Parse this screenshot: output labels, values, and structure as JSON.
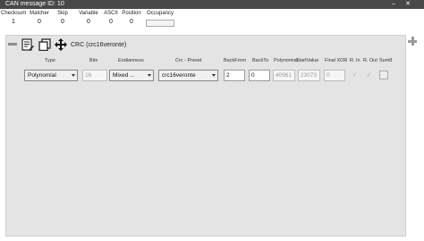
{
  "window": {
    "title": "CAN message ID: 10"
  },
  "stats": [
    {
      "label": "Checksum",
      "value": "1"
    },
    {
      "label": "Matcher",
      "value": "0"
    },
    {
      "label": "Skip",
      "value": "0"
    },
    {
      "label": "Variable",
      "value": "0"
    },
    {
      "label": "ASCII",
      "value": "0"
    },
    {
      "label": "Position",
      "value": "0"
    },
    {
      "label": "Occupancy",
      "value": ""
    }
  ],
  "block": {
    "title": "CRC (crc16veronte)",
    "columns": {
      "type": "Type",
      "bits": "Bits",
      "endianness": "Endianness",
      "preset": "Crc - Preset",
      "back_from": "BackFrom",
      "back_to": "BackTo",
      "polynomial": "Polynomial",
      "start_value": "StartValue",
      "final_xor": "Final XOR",
      "r_in": "R. In",
      "r_out": "R. Out",
      "sum8": "Sum8"
    },
    "values": {
      "type": "Polynomial",
      "bits": "16",
      "endianness": "Mixed ...",
      "preset": "crc16veronte",
      "back_from": "2",
      "back_to": "0",
      "polynomial": "40961",
      "start_value": "23073",
      "final_xor": "0"
    }
  },
  "icons": {
    "minus": "minus-icon",
    "edit": "edit-list-icon",
    "copy": "copy-icon",
    "move": "move-icon",
    "add": "plus-icon"
  }
}
